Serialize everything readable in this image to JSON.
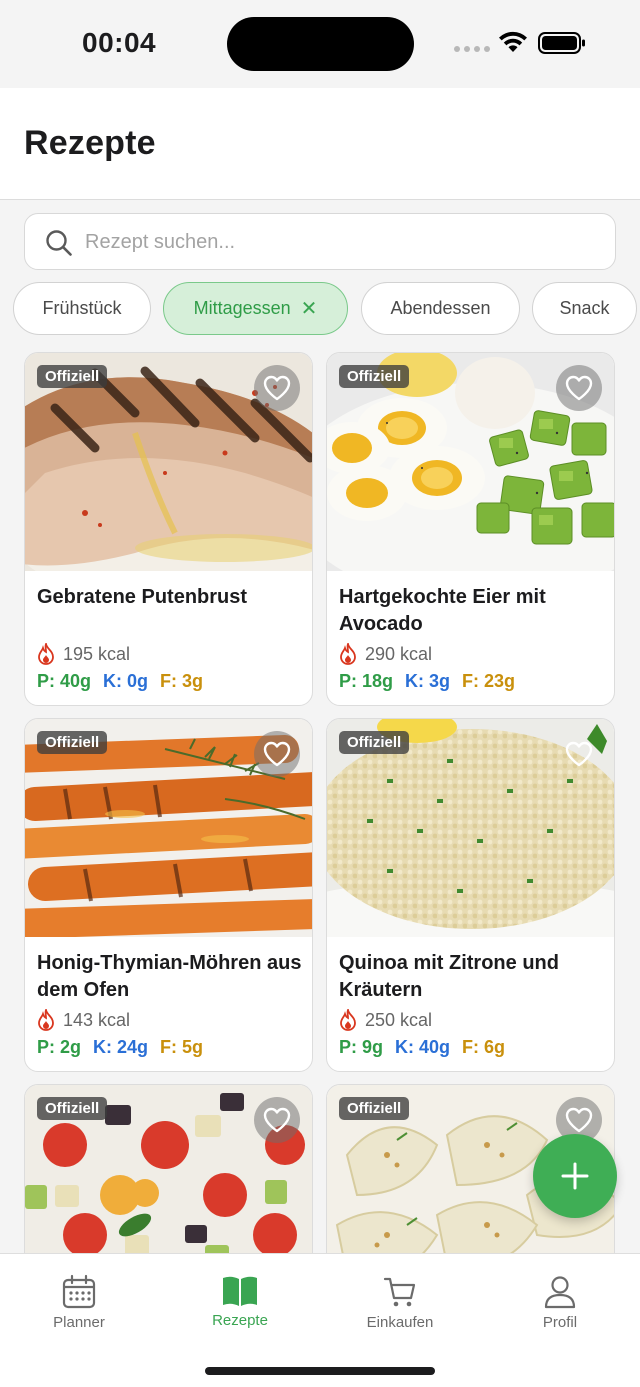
{
  "status": {
    "time": "00:04"
  },
  "header": {
    "title": "Rezepte"
  },
  "search": {
    "placeholder": "Rezept suchen..."
  },
  "filters": [
    {
      "label": "Frühstück",
      "active": false
    },
    {
      "label": "Mittagessen",
      "active": true,
      "clear_glyph": "✕"
    },
    {
      "label": "Abendessen",
      "active": false
    },
    {
      "label": "Snack",
      "active": false
    }
  ],
  "recipes": [
    {
      "badge": "Offiziell",
      "title": "Gebratene Putenbrust",
      "kcal": "195 kcal",
      "p": "P: 40g",
      "k": "K: 0g",
      "f": "F: 3g",
      "favorite_icon": "heart-outline-icon"
    },
    {
      "badge": "Offiziell",
      "title": "Hartgekochte Eier mit Avocado",
      "kcal": "290 kcal",
      "p": "P: 18g",
      "k": "K: 3g",
      "f": "F: 23g",
      "favorite_icon": "heart-outline-icon"
    },
    {
      "badge": "Offiziell",
      "title": "Honig-Thymian-Möhren aus dem Ofen",
      "kcal": "143 kcal",
      "p": "P: 2g",
      "k": "K: 24g",
      "f": "F: 5g",
      "favorite_icon": "heart-outline-icon"
    },
    {
      "badge": "Offiziell",
      "title": "Quinoa mit Zitrone und Kräutern",
      "kcal": "250 kcal",
      "p": "P: 9g",
      "k": "K: 40g",
      "f": "F: 6g",
      "favorite_icon": "heart-outline-icon"
    },
    {
      "badge": "Offiziell",
      "favorite_icon": "heart-outline-icon"
    },
    {
      "badge": "Offiziell",
      "favorite_icon": "heart-outline-icon"
    }
  ],
  "tabs": [
    {
      "label": "Planner",
      "icon": "calendar-icon",
      "active": false
    },
    {
      "label": "Rezepte",
      "icon": "book-icon",
      "active": true
    },
    {
      "label": "Einkaufen",
      "icon": "cart-icon",
      "active": false
    },
    {
      "label": "Profil",
      "icon": "person-icon",
      "active": false
    }
  ],
  "colors": {
    "accent": "#3fae55",
    "protein": "#2f9c47",
    "carbs": "#2a6fd6",
    "fat": "#c9900c"
  }
}
